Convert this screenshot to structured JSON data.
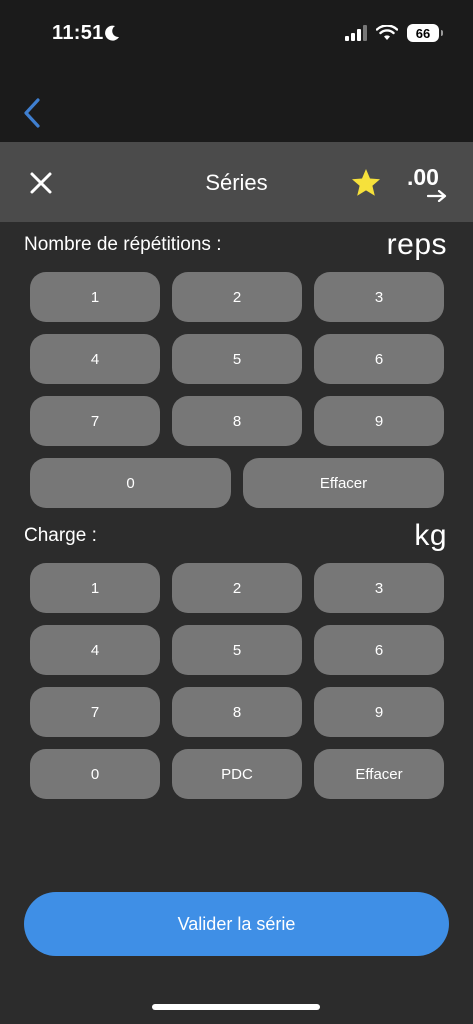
{
  "status_bar": {
    "time": "11:51",
    "battery": "66"
  },
  "header": {
    "title": "Séries"
  },
  "reps_section": {
    "label": "Nombre de répétitions :",
    "unit": "reps",
    "keys": [
      "1",
      "2",
      "3",
      "4",
      "5",
      "6",
      "7",
      "8",
      "9",
      "0",
      "Effacer"
    ]
  },
  "charge_section": {
    "label": "Charge :",
    "unit": "kg",
    "keys": [
      "1",
      "2",
      "3",
      "4",
      "5",
      "6",
      "7",
      "8",
      "9",
      "0",
      "PDC",
      "Effacer"
    ]
  },
  "decimal_toggle": {
    "label": ".00"
  },
  "colors": {
    "accent": "#3f8fe6",
    "star": "#f6e13b",
    "key_bg": "#777777",
    "header_bg": "#4b4b4b"
  },
  "footer": {
    "validate_label": "Valider la série"
  }
}
